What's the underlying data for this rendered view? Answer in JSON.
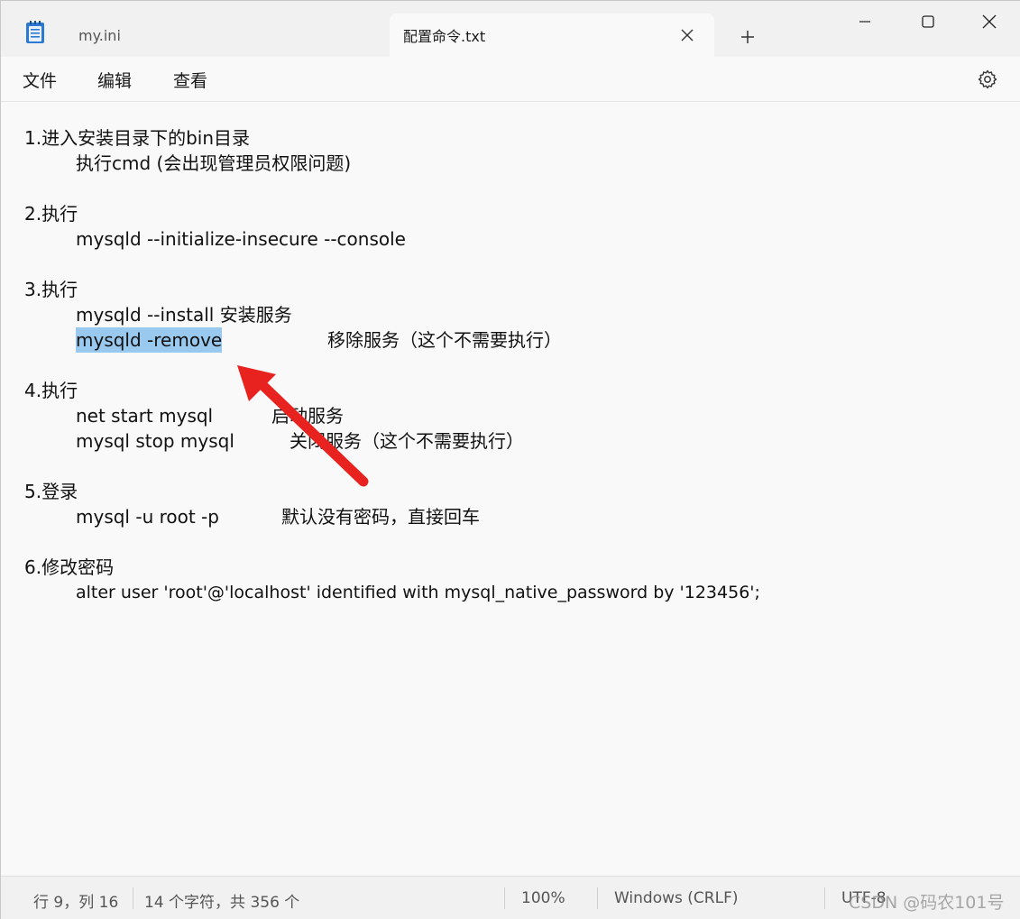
{
  "tabs": {
    "inactive": "my.ini",
    "active": "配置命令.txt",
    "new_tab": "+"
  },
  "menu": {
    "file": "文件",
    "edit": "编辑",
    "view": "查看"
  },
  "content": {
    "l1": "1.进入安装目录下的bin目录",
    "l2": "执行cmd (会出现管理员权限问题)",
    "l3": "2.执行",
    "l4": "mysqld --initialize-insecure --console",
    "l5": "3.执行",
    "l6": "mysqld --install 安装服务",
    "l7_selected": "mysqld -remove",
    "l7_rest": "移除服务（这个不需要执行）",
    "l8": "4.执行",
    "l9_cmd": "net start mysql",
    "l9_desc": "启动服务",
    "l10_cmd": "mysql stop mysql",
    "l10_desc": "关闭服务（这个不需要执行）",
    "l11": "5.登录",
    "l12_cmd": "mysql -u root -p",
    "l12_desc": "默认没有密码，直接回车",
    "l13": "6.修改密码",
    "l14": "alter user 'root'@'localhost' identified with mysql_native_password by '123456';"
  },
  "status": {
    "position": "行 9，列 16",
    "selection": "14 个字符，共 356 个",
    "zoom": "100%",
    "line_ending": "Windows (CRLF)",
    "encoding": "UTF-8"
  },
  "watermark": "CSDN @码农101号",
  "colors": {
    "selection": "#99c9ef",
    "arrow": "#e8231f",
    "notepad_blue": "#1b6fc7"
  },
  "icons": {
    "app": "notepad-icon",
    "close_tab": "close-icon",
    "settings": "gear-icon",
    "minimize": "minimize-icon",
    "maximize": "maximize-icon",
    "close_window": "close-icon"
  }
}
